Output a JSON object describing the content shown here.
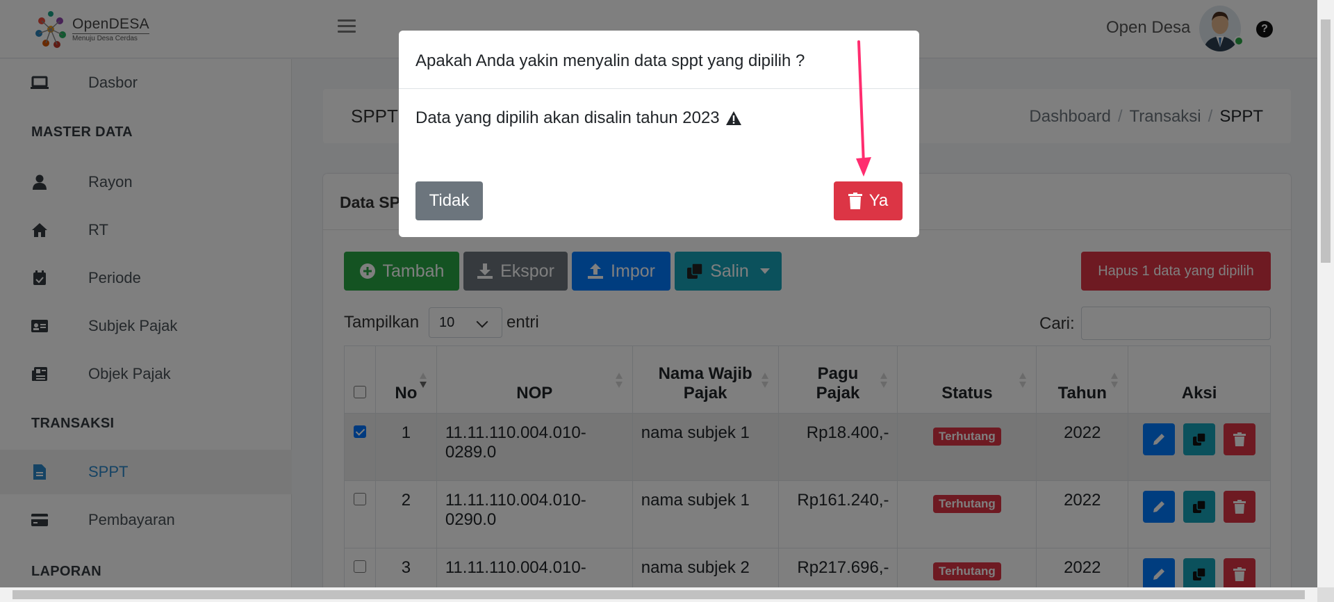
{
  "brand": {
    "name": "OpenDESA",
    "tagline": "Menuju Desa Cerdas"
  },
  "header": {
    "user_name": "Open Desa",
    "help_icon": "question-circle-icon"
  },
  "sidebar": {
    "items_top": [
      {
        "label": "Dasbor",
        "icon": "laptop-icon"
      }
    ],
    "section_master": "MASTER DATA",
    "items_master": [
      {
        "label": "Rayon",
        "icon": "user-icon"
      },
      {
        "label": "RT",
        "icon": "home-icon"
      },
      {
        "label": "Periode",
        "icon": "calendar-check-icon"
      },
      {
        "label": "Subjek Pajak",
        "icon": "id-card-icon"
      },
      {
        "label": "Objek Pajak",
        "icon": "newspaper-icon"
      }
    ],
    "section_transaksi": "TRANSAKSI",
    "items_transaksi": [
      {
        "label": "SPPT",
        "icon": "file-icon",
        "active": true
      },
      {
        "label": "Pembayaran",
        "icon": "credit-card-icon"
      }
    ],
    "section_laporan": "LAPORAN"
  },
  "content": {
    "page_title": "SPPT",
    "breadcrumb": [
      "Dashboard",
      "Transaksi",
      "SPPT"
    ],
    "card_title": "Data SPPT"
  },
  "toolbar": {
    "tambah": "Tambah",
    "ekspor": "Ekspor",
    "impor": "Impor",
    "salin": "Salin",
    "hapus": "Hapus 1 data yang dipilih"
  },
  "table_controls": {
    "show_label": "Tampilkan",
    "length_value": "10",
    "entries_label": "entri",
    "search_label": "Cari:"
  },
  "table": {
    "headers": {
      "no": "No",
      "nop": "NOP",
      "nama_line1": "Nama Wajib",
      "nama_line2": "Pajak",
      "pagu_line1": "Pagu",
      "pagu_line2": "Pajak",
      "status": "Status",
      "tahun": "Tahun",
      "aksi": "Aksi"
    },
    "rows": [
      {
        "checked": true,
        "no": "1",
        "nop_line1": "11.11.110.004.010-",
        "nop_line2": "0289.0",
        "nama": "nama subjek 1",
        "pagu": "Rp18.400,-",
        "status": "Terhutang",
        "tahun": "2022"
      },
      {
        "checked": false,
        "no": "2",
        "nop_line1": "11.11.110.004.010-",
        "nop_line2": "0290.0",
        "nama": "nama subjek 1",
        "pagu": "Rp161.240,-",
        "status": "Terhutang",
        "tahun": "2022"
      },
      {
        "checked": false,
        "no": "3",
        "nop_line1": "11.11.110.004.010-",
        "nop_line2": "",
        "nama": "nama subjek 2",
        "pagu": "Rp217.696,-",
        "status": "Terhutang",
        "tahun": "2022"
      }
    ]
  },
  "modal": {
    "title": "Apakah Anda yakin menyalin data sppt yang dipilih ?",
    "body": "Data yang dipilih akan disalin tahun 2023",
    "body_icon": "warning-triangle-icon",
    "btn_no": "Tidak",
    "btn_yes": "Ya",
    "btn_yes_icon": "trash-icon"
  },
  "colors": {
    "success": "#28a745",
    "secondary": "#6c757d",
    "primary": "#007bff",
    "info": "#17a2b8",
    "danger": "#dc3545",
    "annotation_arrow": "#ff2d6f"
  }
}
